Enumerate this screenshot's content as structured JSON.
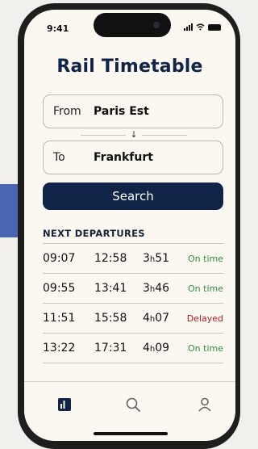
{
  "status_bar": {
    "time": "9:41"
  },
  "app": {
    "title": "Rail Timetable"
  },
  "search_form": {
    "from_label": "From",
    "from_value": "Paris Est",
    "to_label": "To",
    "to_value": "Frankfurt",
    "swap_icon": "arrow-down-icon",
    "search_button_label": "Search"
  },
  "departures": {
    "section_title": "NEXT DEPARTURES",
    "rows": [
      {
        "departure": "09:07",
        "arrival": "12:58",
        "duration_h": "3",
        "duration_unit": "h",
        "duration_m": "51",
        "status": "On time",
        "status_type": "on-time"
      },
      {
        "departure": "09:55",
        "arrival": "13:41",
        "duration_h": "3",
        "duration_unit": "h",
        "duration_m": "46",
        "status": "On time",
        "status_type": "on-time"
      },
      {
        "departure": "11:51",
        "arrival": "15:58",
        "duration_h": "4",
        "duration_unit": "h",
        "duration_m": "07",
        "status": "Delayed",
        "status_type": "delayed"
      },
      {
        "departure": "13:22",
        "arrival": "17:31",
        "duration_h": "4",
        "duration_unit": "h",
        "duration_m": "09",
        "status": "On time",
        "status_type": "on-time"
      }
    ]
  },
  "tab_bar": {
    "items": [
      {
        "name": "home-icon",
        "active": true
      },
      {
        "name": "search-icon",
        "active": false
      },
      {
        "name": "profile-icon",
        "active": false
      }
    ]
  },
  "colors": {
    "brand_navy": "#0f2447",
    "on_time_green": "#2f8a3f",
    "delayed_red": "#b11f1f",
    "screen_background": "#fbf8f2",
    "side_accent": "#4a66b3"
  }
}
